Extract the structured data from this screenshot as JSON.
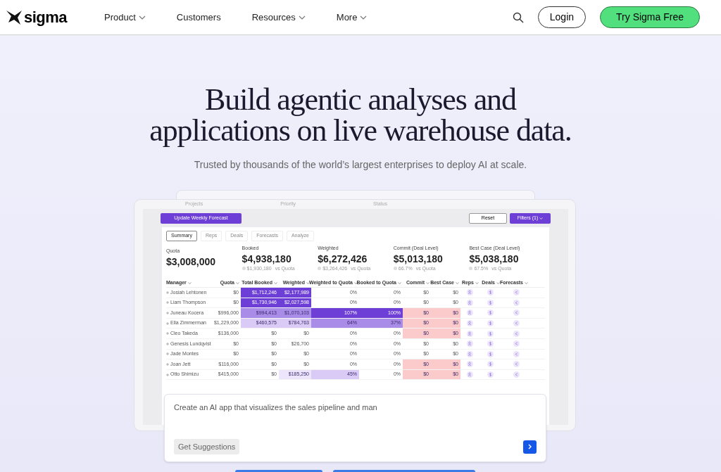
{
  "nav": {
    "brand": "sigma",
    "items": [
      {
        "label": "Product",
        "dropdown": true
      },
      {
        "label": "Customers",
        "dropdown": false
      },
      {
        "label": "Resources",
        "dropdown": true
      },
      {
        "label": "More",
        "dropdown": true
      }
    ],
    "login": "Login",
    "cta": "Try Sigma Free"
  },
  "hero": {
    "title_lines": [
      "Build agentic analyses and",
      "applications on live warehouse data."
    ],
    "subtitle": "Trusted by thousands of the world’s largest enterprises to deploy AI at scale."
  },
  "back_card": {
    "labels": [
      "Projects",
      "Priority",
      "Status"
    ]
  },
  "app": {
    "primary_button": "Update Weekly Forecast",
    "reset": "Reset",
    "filters": "Filters (1)",
    "tabs": [
      {
        "label": "Summary",
        "selected": true
      },
      {
        "label": "Reps",
        "selected": false
      },
      {
        "label": "Deals",
        "selected": false
      },
      {
        "label": "Forecasts",
        "selected": false
      },
      {
        "label": "Analyze",
        "selected": false
      }
    ],
    "metrics": [
      {
        "label": "Quota",
        "value": "$3,008,000"
      },
      {
        "label": "Booked",
        "value": "$4,938,180",
        "note": "$1,930,180",
        "suffix": "vs Quota"
      },
      {
        "label": "Weighted",
        "value": "$6,272,426",
        "note": "$3,264,426",
        "suffix": "vs Quota"
      },
      {
        "label": "Commit (Deal Level)",
        "value": "$5,013,180",
        "note": "66.7%",
        "suffix": "vs Quota"
      },
      {
        "label": "Best Case (Deal Level)",
        "value": "$5,038,180",
        "note": "67.5%",
        "suffix": "vs Quota"
      }
    ],
    "columns": [
      "Manager",
      "Quota",
      "Total Booked",
      "Weighted",
      "Weighted to Quota",
      "Booked to Quota",
      "Commit",
      "Best Case",
      "Reps",
      "Deals",
      "Forecasts"
    ],
    "rows": [
      {
        "cells": [
          {
            "text": "Josiah Lehtonen"
          },
          {
            "text": "$0"
          },
          {
            "text": "$1,712,246",
            "color": "#6d3fd6"
          },
          {
            "text": "$2,177,989",
            "color": "#6d3fd6"
          },
          {
            "text": "0%"
          },
          {
            "text": "0%"
          },
          {
            "text": "$0"
          },
          {
            "text": "$0"
          }
        ]
      },
      {
        "cells": [
          {
            "text": "Liam Thompson"
          },
          {
            "text": "$0"
          },
          {
            "text": "$1,730,946",
            "color": "#6d3fd6"
          },
          {
            "text": "$2,027,598",
            "color": "#6d3fd6"
          },
          {
            "text": "0%"
          },
          {
            "text": "0%"
          },
          {
            "text": "$0"
          },
          {
            "text": "$0"
          }
        ]
      },
      {
        "cells": [
          {
            "text": "Juneau Kocera"
          },
          {
            "text": "$996,000"
          },
          {
            "text": "$994,413",
            "color": "#a98be8"
          },
          {
            "text": "$1,070,103",
            "color": "#a98be8"
          },
          {
            "text": "107%",
            "color": "#6d3fd6"
          },
          {
            "text": "100%",
            "color": "#6d3fd6"
          },
          {
            "text": "$0",
            "color": "#fbcaca"
          },
          {
            "text": "$0",
            "color": "#fbcaca"
          }
        ]
      },
      {
        "cells": [
          {
            "text": "Ella Zimmerman"
          },
          {
            "text": "$1,229,000"
          },
          {
            "text": "$460,575",
            "color": "#d9cbf6"
          },
          {
            "text": "$784,763",
            "color": "#d9cbf6"
          },
          {
            "text": "64%",
            "color": "#a98be8"
          },
          {
            "text": "37%",
            "color": "#a98be8"
          },
          {
            "text": "$0",
            "color": "#fbcaca"
          },
          {
            "text": "$0",
            "color": "#fbcaca"
          }
        ]
      },
      {
        "cells": [
          {
            "text": "Cleo Takeda"
          },
          {
            "text": "$136,000"
          },
          {
            "text": "$0"
          },
          {
            "text": "$0"
          },
          {
            "text": "0%"
          },
          {
            "text": "0%"
          },
          {
            "text": "$0",
            "color": "#fbcaca"
          },
          {
            "text": "$0",
            "color": "#fbcaca"
          }
        ]
      },
      {
        "cells": [
          {
            "text": "Genesis Lundqvist"
          },
          {
            "text": "$0"
          },
          {
            "text": "$0"
          },
          {
            "text": "$26,700"
          },
          {
            "text": "0%"
          },
          {
            "text": "0%"
          },
          {
            "text": "$0"
          },
          {
            "text": "$0"
          }
        ]
      },
      {
        "cells": [
          {
            "text": "Jade Montes"
          },
          {
            "text": "$0"
          },
          {
            "text": "$0"
          },
          {
            "text": "$0"
          },
          {
            "text": "0%"
          },
          {
            "text": "0%"
          },
          {
            "text": "$0"
          },
          {
            "text": "$0"
          }
        ]
      },
      {
        "cells": [
          {
            "text": "Joan Jett"
          },
          {
            "text": "$116,000"
          },
          {
            "text": "$0"
          },
          {
            "text": "$0"
          },
          {
            "text": "0%"
          },
          {
            "text": "0%"
          },
          {
            "text": "$0",
            "color": "#fbcaca"
          },
          {
            "text": "$0",
            "color": "#fbcaca"
          }
        ]
      },
      {
        "cells": [
          {
            "text": "Otto Shimizu"
          },
          {
            "text": "$415,000"
          },
          {
            "text": "$0"
          },
          {
            "text": "$185,250",
            "color": "#ece5fb"
          },
          {
            "text": "45%",
            "color": "#d9cbf6"
          },
          {
            "text": "0%"
          },
          {
            "text": "$0",
            "color": "#fbcaca"
          },
          {
            "text": "$0",
            "color": "#fbcaca"
          }
        ]
      }
    ]
  },
  "prompt": {
    "value": "Create an AI app that visualizes the sales pipeline and man",
    "suggestions": "Get Suggestions"
  }
}
